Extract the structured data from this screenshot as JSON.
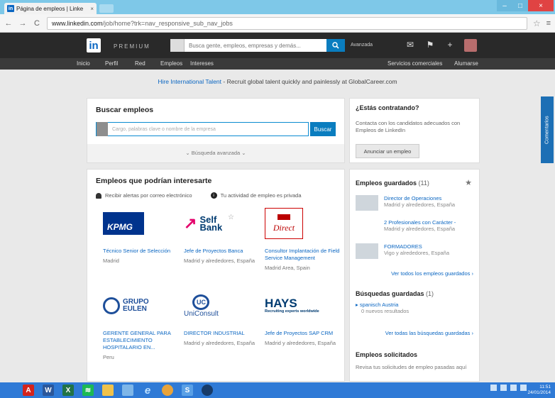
{
  "browser": {
    "tab_title": "Página de empleos | Linke",
    "tab_favicon": "in",
    "tab_close": "×",
    "url_domain": "www.linkedin.com",
    "url_path": "/job/home?trk=nav_responsive_sub_nav_jobs",
    "back": "←",
    "forward": "→",
    "reload": "C",
    "star": "☆",
    "menu": "≡",
    "win_min": "–",
    "win_max": "□",
    "win_close": "×"
  },
  "linkedin": {
    "logo": "in",
    "premium": "PREMIUM",
    "search_placeholder": "Busca gente, empleos, empresas y demás...",
    "search_icon": "search-icon",
    "advanced": "Avanzada",
    "nav": [
      "Inicio",
      "Perfil",
      "Red",
      "Empleos",
      "Intereses"
    ],
    "nav_right": [
      "Servicios comerciales",
      "Alumarse"
    ]
  },
  "banner": {
    "highlight": "Hire International Talent",
    "text": " - Recruit global talent quickly and painlessly at GlobalCareer.com"
  },
  "search_jobs": {
    "title": "Buscar empleos",
    "placeholder": "Cargo, palabras clave o nombre de la empresa",
    "button": "Buscar",
    "advanced": "Búsqueda avanzada"
  },
  "jobs": {
    "title": "Empleos que podrían interesarte",
    "alert_email": "Recibir alertas por correo electrónico",
    "activity_private": "Tu actividad de empleo es privada",
    "items": [
      {
        "company": "KPMG",
        "title": "Técnico Senior de Selección",
        "location": "Madrid"
      },
      {
        "company": "Self Bank",
        "title": "Jefe de Proyectos Banca",
        "location": "Madrid y alrededores, España"
      },
      {
        "company": "Direct",
        "title": "Consultor Implantación de Field Service Management",
        "location": "Madrid Area, Spain"
      },
      {
        "company": "GRUPO EULEN",
        "title": "GERENTE GENERAL PARA ESTABLECIMIENTO HOSPITALARIO EN...",
        "location": "Peru"
      },
      {
        "company": "UniConsult",
        "title": "DIRECTOR INDUSTRIAL",
        "location": "Madrid y alrededores, España"
      },
      {
        "company": "HAYS",
        "title": "Jefe de Proyectos SAP CRM",
        "location": "Madrid y alrededores, España"
      }
    ],
    "logos": {
      "self_line1": "Self",
      "self_line2": "Bank",
      "eulen_line1": "GRUPO",
      "eulen_line2": "EULEN",
      "uni_circle": "UC",
      "uni_name": "UniConsult",
      "hays_name": "HAYS",
      "hays_tag": "Recruiting experts worldwide",
      "direct_text": "Direct"
    }
  },
  "hiring": {
    "title": "¿Estás contratando?",
    "text": "Contacta con los candidatos adecuados con Empleos de LinkedIn",
    "button": "Anunciar un empleo"
  },
  "saved": {
    "title": "Empleos guardados",
    "count": "(11)",
    "items": [
      {
        "title": "Director de Operaciones",
        "sub": "Madrid y alrededores, España"
      },
      {
        "title": "2 Profesionales con Carácter -",
        "sub": "Madrid y alrededores, España"
      },
      {
        "title": "FORMADORES",
        "sub": "Vigo y alrededores, España"
      }
    ],
    "see_all": "Ver todos los empleos guardados",
    "searches_title": "Búsquedas guardadas",
    "searches_count": "(1)",
    "search_item": "spanisch Austria",
    "search_sub": "0 nuevos resultados",
    "see_all_searches": "Ver todas las búsquedas guardadas",
    "applied_title": "Empleos solicitados",
    "applied_text": "Revisa tus solicitudes de empleo pasadas aquí"
  },
  "side_tab": "Comentarios",
  "taskbar": {
    "time": "11:51",
    "date": "24/01/2014"
  },
  "colors": {
    "linkedin_blue": "#0a66c2",
    "nav_dark": "#292929",
    "taskbar": "#2f7ad6"
  }
}
